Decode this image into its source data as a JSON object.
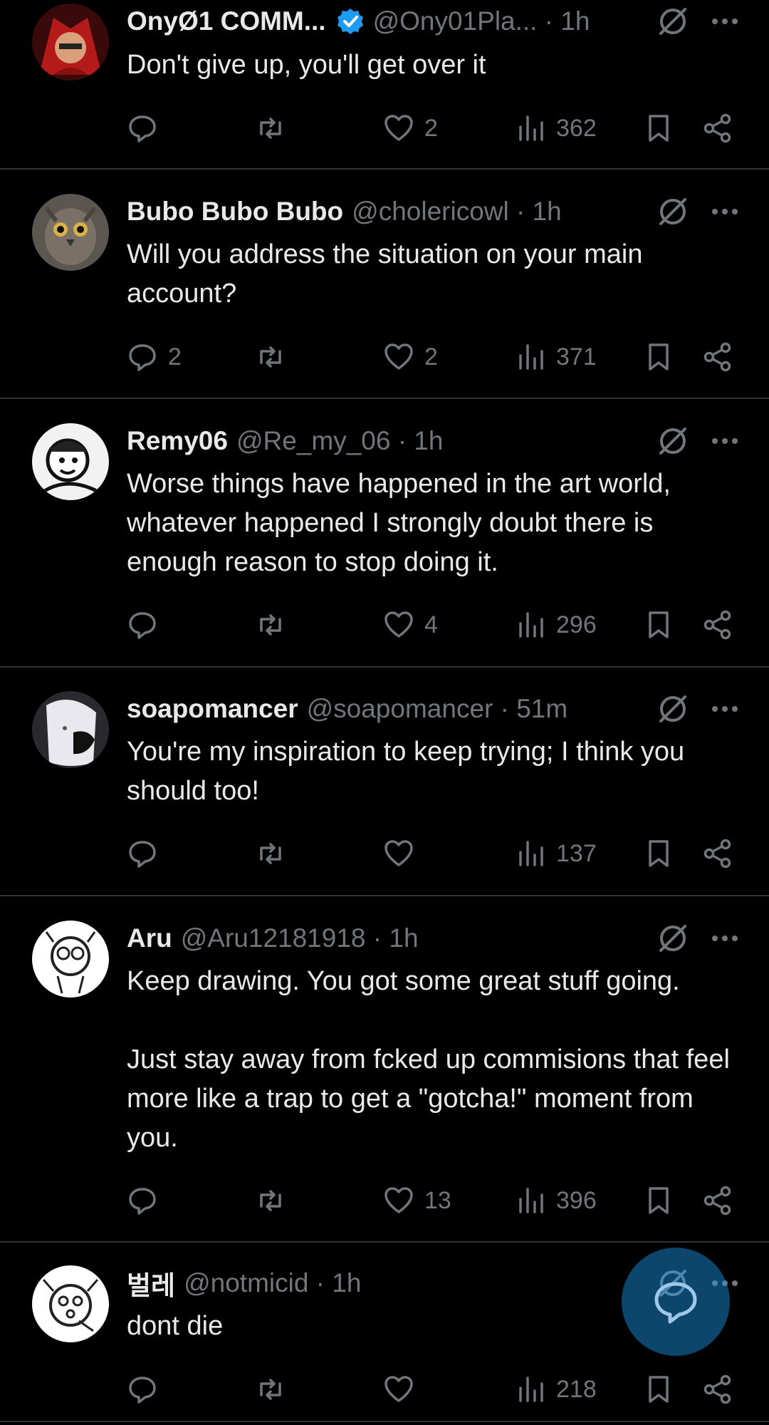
{
  "tweets": [
    {
      "name": "OnyØ1 COMM...",
      "handle": "@Ony01Pla... · 1h",
      "verified": true,
      "text": "Don't give up, you'll get over it",
      "replies": "",
      "likes": "2",
      "views": "362"
    },
    {
      "name": "Bubo Bubo Bubo",
      "handle": "@cholericowl · 1h",
      "verified": false,
      "text": "Will you address the situation on your main account?",
      "replies": "2",
      "likes": "2",
      "views": "371"
    },
    {
      "name": "Remy06",
      "handle": "@Re_my_06 · 1h",
      "verified": false,
      "text": "Worse things have happened in the art world, whatever happened I strongly doubt there is enough reason to stop doing it.",
      "replies": "",
      "likes": "4",
      "views": "296"
    },
    {
      "name": "soapomancer",
      "handle": "@soapomancer · 51m",
      "verified": false,
      "text": "You're my inspiration to keep trying; I think you should too!",
      "replies": "",
      "likes": "",
      "views": "137"
    },
    {
      "name": "Aru",
      "handle": "@Aru12181918 · 1h",
      "verified": false,
      "text": "Keep drawing. You got some great stuff going.\n\nJust stay away from fcked up commisions that feel more like a trap to get a \"gotcha!\" moment from you.",
      "replies": "",
      "likes": "13",
      "views": "396"
    },
    {
      "name": "벌레",
      "handle": "@notmicid · 1h",
      "verified": false,
      "text": "dont die",
      "replies": "",
      "likes": "",
      "views": "218"
    }
  ],
  "icons": {
    "reply": "reply-icon",
    "retweet": "retweet-icon",
    "like": "heart-icon",
    "views": "views-icon",
    "bookmark": "bookmark-icon",
    "share": "share-icon",
    "grok": "grok-icon",
    "more": "more-icon",
    "fab": "compose-reply-icon"
  },
  "colors": {
    "background": "#000000",
    "text": "#e7e9ea",
    "muted": "#71767b",
    "divider": "#2f3336",
    "accent": "#1d9bf0"
  }
}
